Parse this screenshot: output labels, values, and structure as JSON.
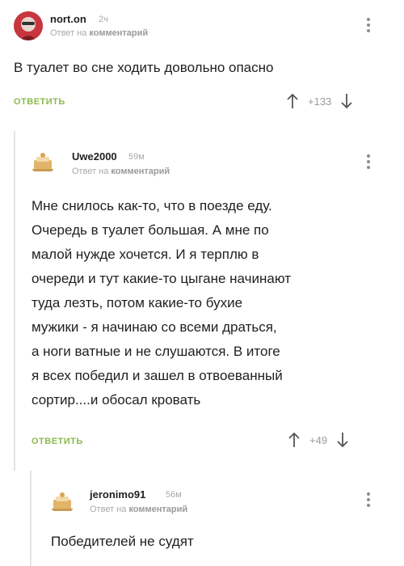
{
  "comments": [
    {
      "username": "nort.on",
      "time": "2ч",
      "reply_prefix": "Ответ на",
      "reply_target": "комментарий",
      "text": "В туалет во сне ходить довольно опасно",
      "reply_label": "ОТВЕТИТЬ",
      "rating": "+133"
    },
    {
      "username": "Uwe2000",
      "time": "59м",
      "reply_prefix": "Ответ на",
      "reply_target": "комментарий",
      "text_lines": [
        "Мне снилось как-то, что в поезде еду.",
        "Очередь в туалет большая. А мне по",
        "малой нужде хочется.  И я терплю в",
        "очереди и тут какие-то цыгане начинают",
        "туда лезть, потом какие-то бухие",
        "мужики - я начинаю со всеми драться,",
        "а ноги ватные и не слушаются. В итоге",
        "я всех победил и зашел в отвоеванный",
        "сортир....и обосал кровать"
      ],
      "reply_label": "ОТВЕТИТЬ",
      "rating": "+49"
    },
    {
      "username": "jeronimo91",
      "time": "56м",
      "reply_prefix": "Ответ на",
      "reply_target": "комментарий",
      "text": "Победителей не судят"
    }
  ],
  "icons": {
    "upvote": "arrow-up-icon",
    "downvote": "arrow-down-icon",
    "more": "more-vertical-icon"
  },
  "colors": {
    "accent": "#8ab94e",
    "muted": "#a9a9a9",
    "thread_line": "#e4e4e4"
  }
}
